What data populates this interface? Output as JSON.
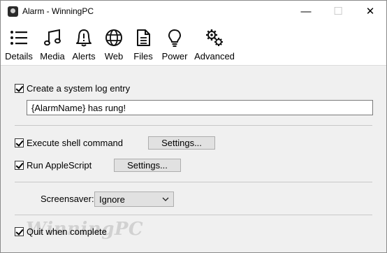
{
  "window": {
    "title": "Alarm - WinningPC",
    "minimize_glyph": "—",
    "maximize_glyph": "☐",
    "close_glyph": "✕"
  },
  "toolbar": {
    "items": [
      {
        "label": "Details",
        "icon": "list-icon"
      },
      {
        "label": "Media",
        "icon": "music-note-icon"
      },
      {
        "label": "Alerts",
        "icon": "bell-icon"
      },
      {
        "label": "Web",
        "icon": "globe-icon"
      },
      {
        "label": "Files",
        "icon": "document-icon"
      },
      {
        "label": "Power",
        "icon": "lightbulb-icon"
      },
      {
        "label": "Advanced",
        "icon": "gears-icon"
      }
    ]
  },
  "content": {
    "log_entry": {
      "label": "Create a system log entry",
      "checked": true,
      "value": "{AlarmName} has rung!"
    },
    "shell": {
      "label": "Execute shell command",
      "checked": true,
      "button": "Settings..."
    },
    "applescript": {
      "label": "Run AppleScript",
      "checked": true,
      "button": "Settings..."
    },
    "screensaver": {
      "label": "Screensaver:",
      "selected": "Ignore"
    },
    "quit": {
      "label": "Quit when complete",
      "checked": true
    }
  },
  "watermark": "WinningPC"
}
